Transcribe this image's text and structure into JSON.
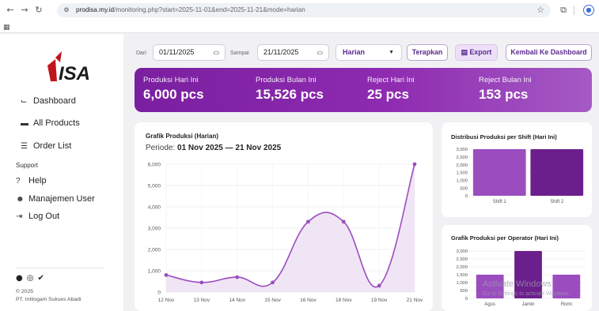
{
  "browser": {
    "host": "prodisa.my.id",
    "path": "/monitoring.php?start=2025-11-01&end=2025-11-21&mode=harian",
    "apps_icon": "apps-grid-icon"
  },
  "sidebar": {
    "logo_text": "ISA",
    "items": [
      {
        "label": "Dashboard",
        "icon": "chart-line-icon"
      },
      {
        "label": "All Products",
        "icon": "box-icon"
      },
      {
        "label": "Order List",
        "icon": "list-icon"
      }
    ],
    "section_label": "Support",
    "support_items": [
      {
        "label": "Help",
        "icon": "question-icon"
      },
      {
        "label": "Manajemen User",
        "icon": "users-icon"
      },
      {
        "label": "Log Out",
        "icon": "logout-icon"
      }
    ],
    "copyright_year": "© 2025",
    "copyright_company": "PT. Intilogam Sukses Abadi"
  },
  "filters": {
    "from_label": "Dari",
    "from_value": "01/11/2025",
    "to_label": "Sampai",
    "to_value": "21/11/2025",
    "mode": "Harian",
    "apply_label": "Terapkan",
    "export_label": "Export",
    "back_label": "Kembali Ke Dashboard"
  },
  "stats": [
    {
      "label": "Produksi Hari Ini",
      "value": "6,000 pcs"
    },
    {
      "label": "Produksi Bulan Ini",
      "value": "15,526 pcs"
    },
    {
      "label": "Reject Hari Ini",
      "value": "25 pcs"
    },
    {
      "label": "Reject Bulan Ini",
      "value": "153 pcs"
    }
  ],
  "main_chart": {
    "title": "Grafik Produksi (Harian)",
    "periode_label": "Periode:",
    "periode_value": "01 Nov 2025 — 21 Nov 2025"
  },
  "shift_chart": {
    "title": "Distribusi Produksi per Shift (Hari Ini)"
  },
  "operator_chart": {
    "title": "Grafik Produksi per Operator (Hari Ini)"
  },
  "watermark": {
    "title": "Activate Windows",
    "subtitle": "Go to Settings to activate Windows."
  },
  "colors": {
    "accent": "#7a1fa0",
    "line": "#9b4dc0",
    "fill": "#eadcf2",
    "bar_light": "#9b4dc0",
    "bar_dark": "#6b1f8c"
  },
  "chart_data": [
    {
      "type": "line",
      "title": "Grafik Produksi (Harian)",
      "x": [
        "12 Nov",
        "13 Nov",
        "14 Nov",
        "15 Nov",
        "16 Nov",
        "18 Nov",
        "19 Nov",
        "21 Nov"
      ],
      "series": [
        {
          "values": [
            800,
            450,
            700,
            450,
            3300,
            3300,
            300,
            6000
          ]
        }
      ],
      "ylim": [
        0,
        6000
      ],
      "yticks": [
        "0",
        "1,000",
        "2,000",
        "3,000",
        "4,000",
        "5,000",
        "6,000"
      ],
      "grid": true
    },
    {
      "type": "bar",
      "title": "Distribusi Produksi per Shift (Hari Ini)",
      "categories": [
        "Shift 1",
        "Shift 2"
      ],
      "values": [
        3000,
        3000
      ],
      "ylim": [
        0,
        3000
      ],
      "yticks": [
        "0",
        "500",
        "1,000",
        "1,500",
        "2,000",
        "2,500",
        "3,000"
      ]
    },
    {
      "type": "bar",
      "title": "Grafik Produksi per Operator (Hari Ini)",
      "categories": [
        "Agus",
        "Jamin",
        "Romi"
      ],
      "values": [
        1500,
        3000,
        1500
      ],
      "ylim": [
        0,
        3000
      ],
      "yticks": [
        "0",
        "500",
        "1,000",
        "1,500",
        "2,000",
        "2,500",
        "3,000"
      ]
    }
  ]
}
